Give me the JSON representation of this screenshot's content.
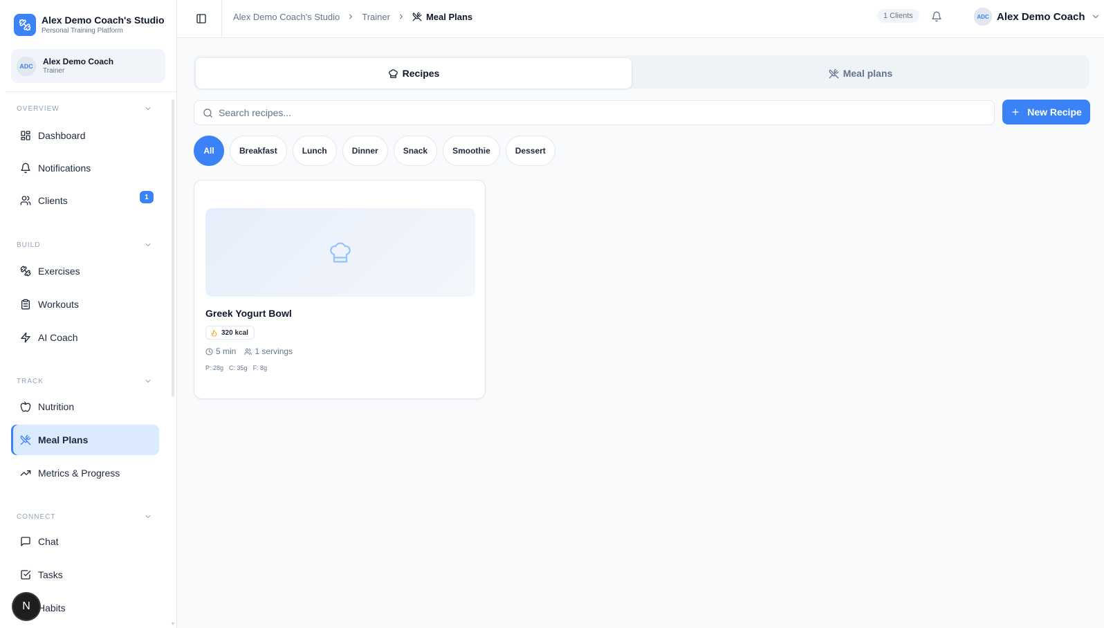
{
  "brand": {
    "title": "Alex Demo Coach's Studio",
    "subtitle": "Personal Training Platform"
  },
  "user": {
    "initials": "ADC",
    "name": "Alex Demo Coach",
    "role": "Trainer"
  },
  "sidebar": {
    "sections": [
      {
        "label": "OVERVIEW",
        "items": [
          {
            "label": "Dashboard",
            "icon": "grid-icon"
          },
          {
            "label": "Notifications",
            "icon": "bell-icon"
          },
          {
            "label": "Clients",
            "icon": "users-icon",
            "badge": "1"
          }
        ]
      },
      {
        "label": "BUILD",
        "items": [
          {
            "label": "Exercises",
            "icon": "dumbbell-icon"
          },
          {
            "label": "Workouts",
            "icon": "clipboard-icon"
          },
          {
            "label": "AI Coach",
            "icon": "lightning-icon"
          }
        ]
      },
      {
        "label": "TRACK",
        "items": [
          {
            "label": "Nutrition",
            "icon": "apple-icon"
          },
          {
            "label": "Meal Plans",
            "icon": "utensils-icon",
            "active": true
          },
          {
            "label": "Metrics & Progress",
            "icon": "trending-icon"
          }
        ]
      },
      {
        "label": "CONNECT",
        "items": [
          {
            "label": "Chat",
            "icon": "message-icon"
          },
          {
            "label": "Tasks",
            "icon": "checkbox-icon"
          },
          {
            "label": "Habits",
            "icon": "habit-icon"
          }
        ]
      }
    ],
    "fab_letter": "N"
  },
  "topbar": {
    "breadcrumbs": [
      "Alex Demo Coach's Studio",
      "Trainer",
      "Meal Plans"
    ],
    "clients_pill": "1 Clients",
    "user_initials": "ADC",
    "user_name": "Alex Demo Coach"
  },
  "tabs": {
    "recipes": "Recipes",
    "meal_plans": "Meal plans",
    "active": "recipes"
  },
  "search": {
    "placeholder": "Search recipes...",
    "value": ""
  },
  "new_recipe_label": "New Recipe",
  "categories": [
    "All",
    "Breakfast",
    "Lunch",
    "Dinner",
    "Snack",
    "Smoothie",
    "Dessert"
  ],
  "active_category": "All",
  "recipes": [
    {
      "title": "Greek Yogurt Bowl",
      "kcal": "320 kcal",
      "time": "5 min",
      "servings": "1 servings",
      "protein": "P: 28g",
      "carbs": "C: 35g",
      "fat": "F: 8g"
    }
  ],
  "colors": {
    "accent": "#3b82f6",
    "active_nav_bg": "#dbeafe",
    "page_bg": "#f8fafc"
  }
}
